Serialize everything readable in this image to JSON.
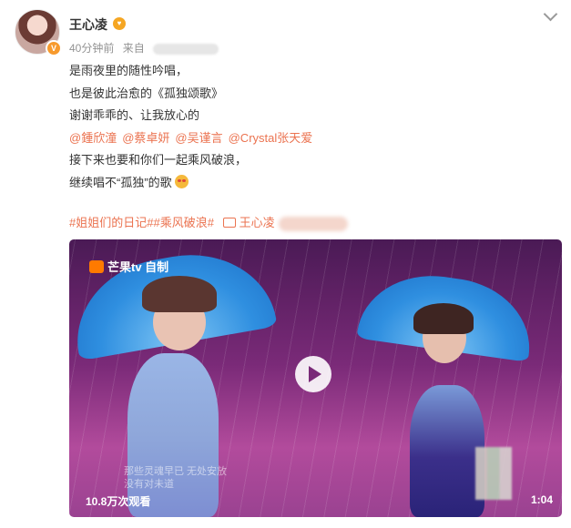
{
  "post": {
    "username": "王心凌",
    "verified_badge": "V",
    "member_badge": "♥",
    "time": "40分钟前",
    "source_prefix": "来自",
    "content_lines": [
      "是雨夜里的随性吟唱，",
      "也是彼此治愈的《孤独颂歌》",
      "谢谢乖乖的、让我放心的"
    ],
    "mentions": [
      "@鍾欣潼",
      "@蔡卓妍",
      "@吴谨言",
      "@Crystal张天爱"
    ],
    "content_after": [
      "接下来也要和你们一起乘风破浪，",
      "继续唱不“孤独”的歌"
    ],
    "tags": [
      "#姐姐们的日记#",
      "#乘风破浪#"
    ],
    "link_label": "王心凌"
  },
  "video": {
    "logo_text": "芒果tv 自制",
    "subtitle_lines": [
      "那些灵魂早已  无处安放",
      "没有对未道"
    ],
    "views": "10.8万次观看",
    "duration": "1:04"
  },
  "colors": {
    "link": "#eb7350",
    "text": "#333333",
    "meta": "#939393"
  }
}
